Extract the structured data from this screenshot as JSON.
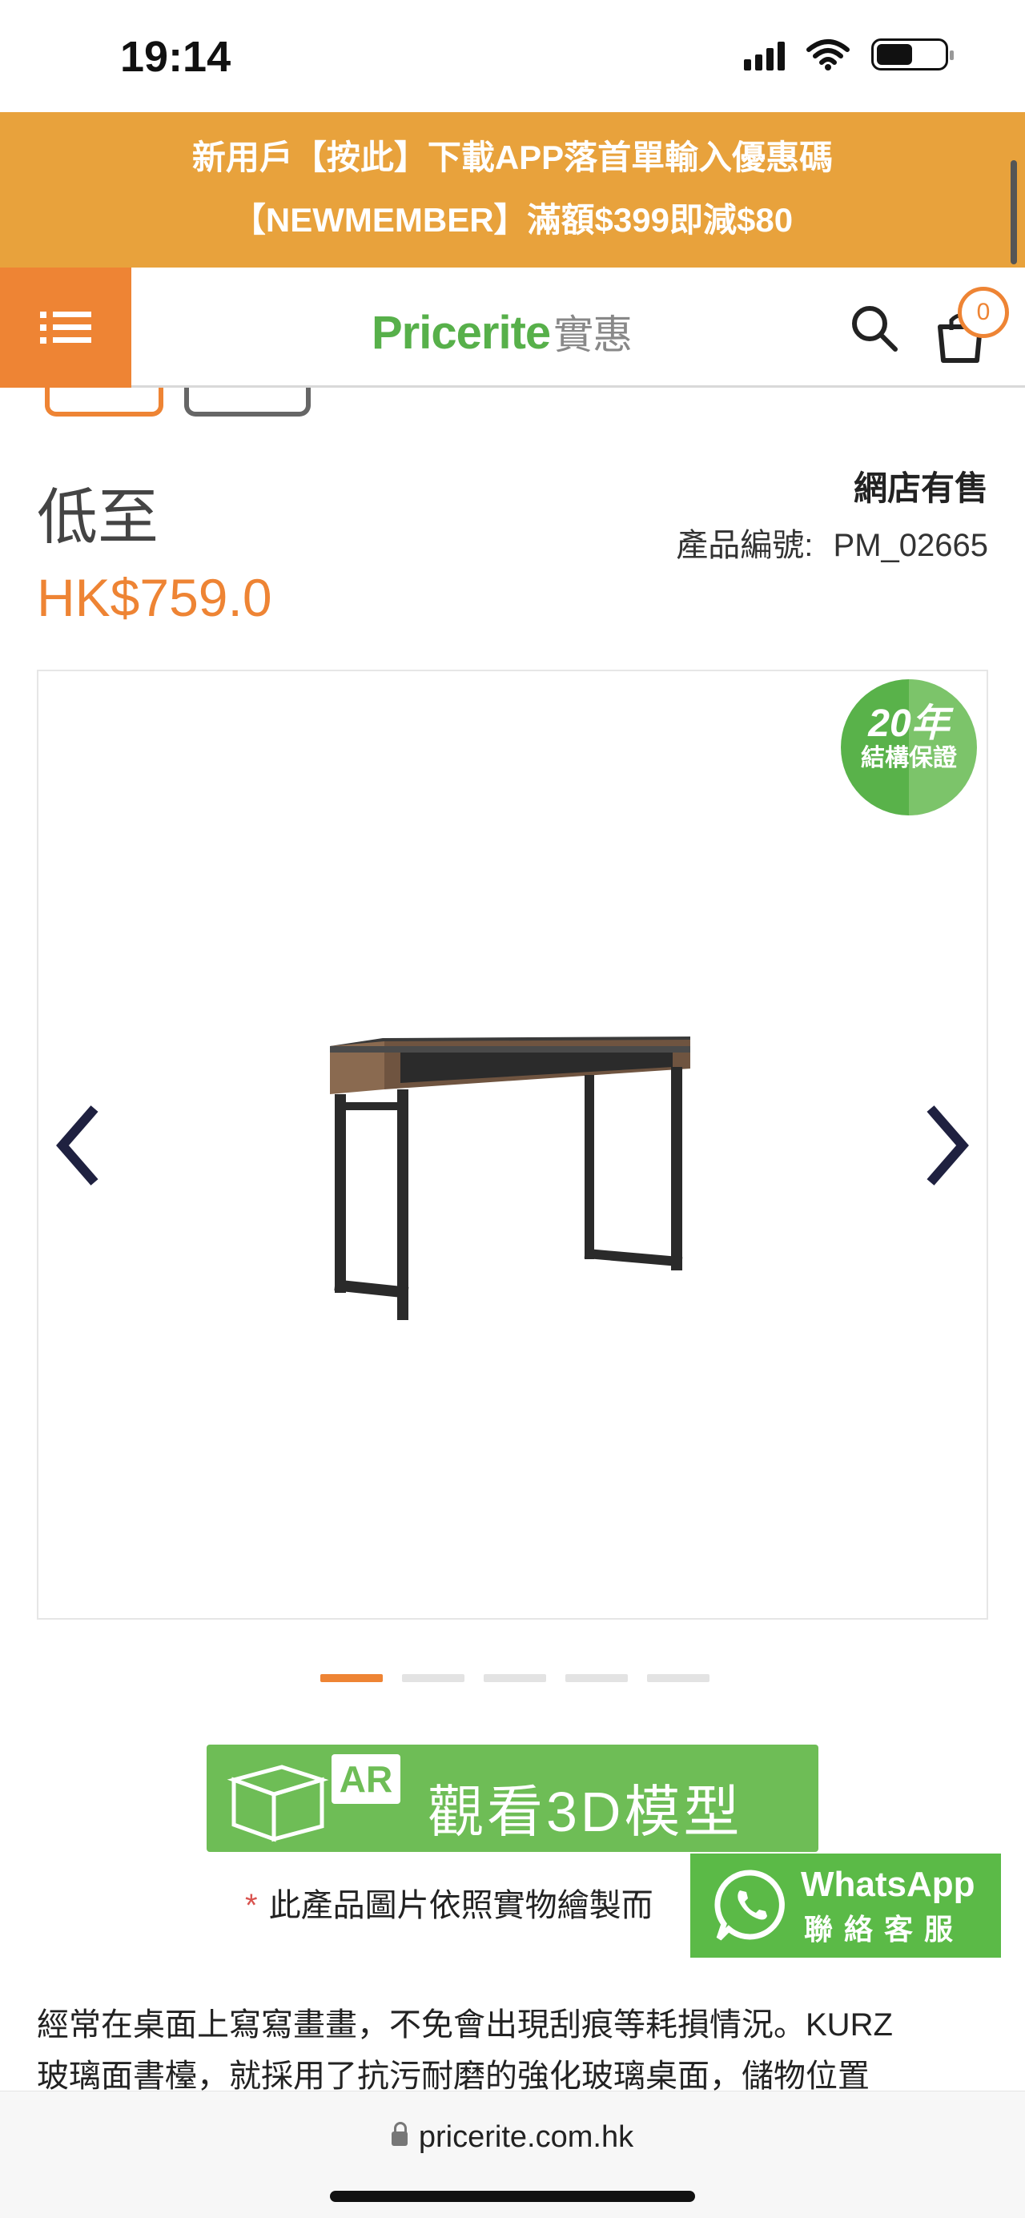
{
  "status_bar": {
    "time": "19:14"
  },
  "promo": {
    "line1": "新用戶【按此】下載APP落首單輸入優惠碼",
    "line2": "【NEWMEMBER】滿額$399即減$80"
  },
  "header": {
    "logo_en": "Pricerite",
    "logo_zh": "實惠",
    "cart_count": "0"
  },
  "product": {
    "name": "低至",
    "price": "HK$759.0",
    "online_only": "網店有售",
    "code_label": "產品編號:",
    "code": "PM_02665"
  },
  "warranty_badge": {
    "years": "20年",
    "text": "結構保證"
  },
  "carousel": {
    "total_slides": 5,
    "active_index": 0
  },
  "ar_button": {
    "badge": "AR",
    "label": "觀看3D模型"
  },
  "disclaimer": {
    "star": "*",
    "text": "此產品圖片依照實物繪製而"
  },
  "whatsapp": {
    "title": "WhatsApp",
    "subtitle": "聯絡客服"
  },
  "description": {
    "line1": "經常在桌面上寫寫畫畫，不免會出現刮痕等耗損情況。KURZ",
    "line2": "玻璃面書檯，就採用了抗污耐磨的強化玻璃桌面，儲物位置"
  },
  "browser": {
    "url": "pricerite.com.hk"
  },
  "colors": {
    "accent": "#EE8434",
    "promo_bg": "#E8A23C",
    "green": "#57B04A"
  },
  "icons": [
    "menu-icon",
    "search-icon",
    "cart-icon",
    "chevron-left-icon",
    "chevron-right-icon",
    "whatsapp-icon",
    "lock-icon",
    "cube-icon"
  ]
}
